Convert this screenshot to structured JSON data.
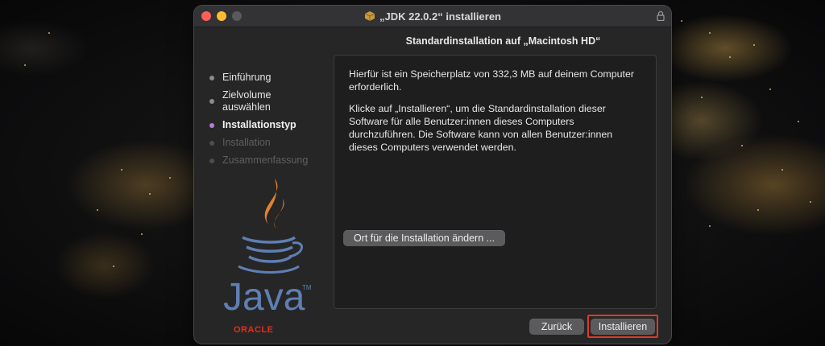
{
  "window": {
    "title": "„JDK 22.0.2“ installieren",
    "icons": [
      "package-icon",
      "lock-icon"
    ]
  },
  "header": {
    "title": "Standardinstallation auf „Macintosh HD“"
  },
  "sidebar": {
    "steps": [
      {
        "label": "Einführung",
        "state": "done"
      },
      {
        "label": "Zielvolume\nauswählen",
        "state": "done"
      },
      {
        "label": "Installationstyp",
        "state": "active"
      },
      {
        "label": "Installation",
        "state": "pending"
      },
      {
        "label": "Zusammenfassung",
        "state": "pending"
      }
    ],
    "logo_text": "Java",
    "vendor": "ORACLE"
  },
  "main": {
    "paragraph1": "Hierfür ist ein Speicherplatz von 332,3 MB auf deinem Computer erforderlich.",
    "paragraph2": "Klicke auf „Installieren“, um die Standardinstallation dieser Software für alle Benutzer:innen dieses Computers durchzuführen. Die Software kann von allen Benutzer:innen dieses Computers verwendet werden.",
    "change_location_label": "Ort für die Installation ändern ..."
  },
  "footer": {
    "back_label": "Zurück",
    "install_label": "Installieren"
  },
  "colors": {
    "active_step": "#b47cd9",
    "close": "#ff5f57",
    "minimize": "#febc2e",
    "highlight": "#e03a22",
    "oracle": "#e52d1c"
  }
}
